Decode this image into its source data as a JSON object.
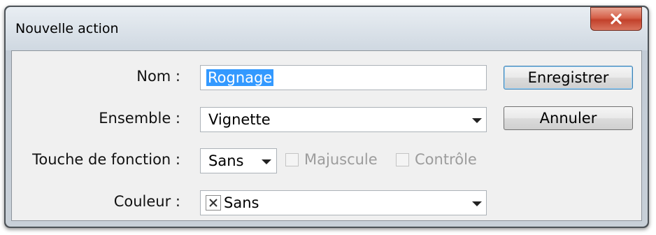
{
  "dialog": {
    "title": "Nouvelle action",
    "close_icon": "close-icon",
    "close_color": "#c94a34"
  },
  "form": {
    "name_label": "Nom :",
    "name_value": "Rognage",
    "set_label": "Ensemble :",
    "set_value": "Vignette",
    "function_key_label": "Touche de fonction :",
    "function_key_value": "Sans",
    "shift_label": "Majuscule",
    "shift_checked": false,
    "control_label": "Contrôle",
    "control_checked": false,
    "color_label": "Couleur :",
    "color_value": "Sans",
    "color_swatch_icon": "x-icon"
  },
  "buttons": {
    "save_label": "Enregistrer",
    "cancel_label": "Annuler"
  },
  "colors": {
    "selection": "#3399ff",
    "default_button_border": "#3c7fb1"
  }
}
